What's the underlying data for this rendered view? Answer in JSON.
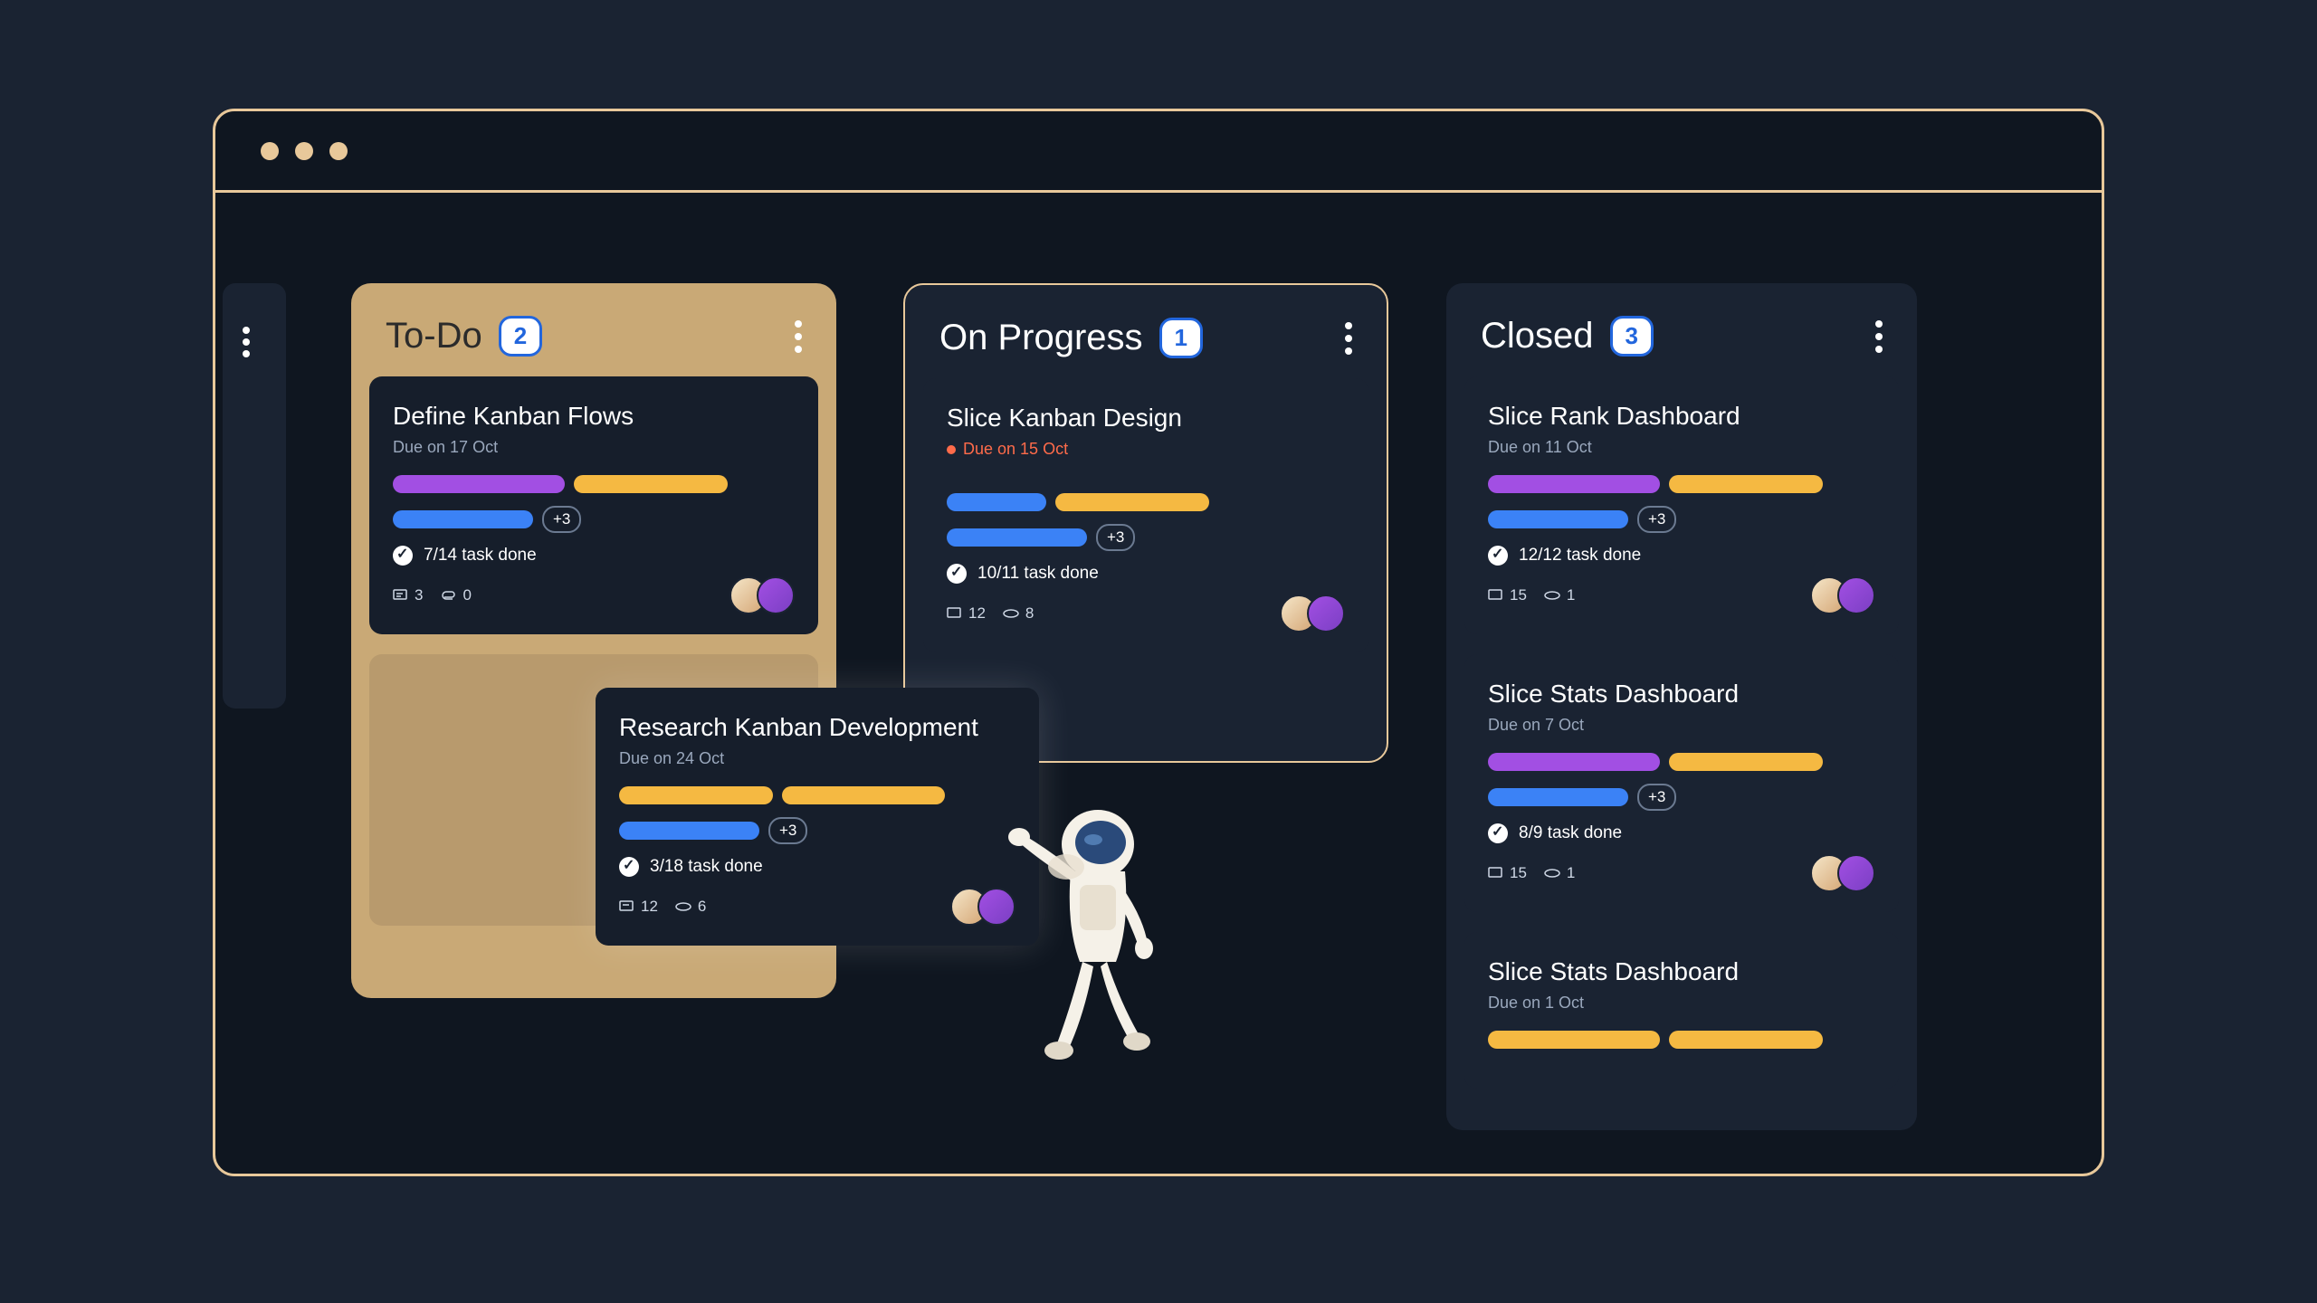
{
  "columns": {
    "todo": {
      "title": "To-Do",
      "count": "2"
    },
    "progress": {
      "title": "On Progress",
      "count": "1"
    },
    "closed": {
      "title": "Closed",
      "count": "3"
    }
  },
  "cards": {
    "todo1": {
      "title": "Define Kanban Flows",
      "due": "Due on 17 Oct",
      "more": "+3",
      "progress": "7/14 task done",
      "comments": "3",
      "attachments": "0"
    },
    "floating": {
      "title": "Research Kanban Development",
      "due": "Due on 24 Oct",
      "more": "+3",
      "progress": "3/18 task done",
      "comments": "12",
      "attachments": "6"
    },
    "prog1": {
      "title": "Slice Kanban Design",
      "due": "Due on 15 Oct",
      "more": "+3",
      "progress": "10/11 task done",
      "comments": "12",
      "attachments": "8"
    },
    "closed1": {
      "title": "Slice Rank Dashboard",
      "due": "Due on 11 Oct",
      "more": "+3",
      "progress": "12/12 task done",
      "comments": "15",
      "attachments": "1"
    },
    "closed2": {
      "title": "Slice Stats Dashboard",
      "due": "Due on 7 Oct",
      "more": "+3",
      "progress": "8/9 task done",
      "comments": "15",
      "attachments": "1"
    },
    "closed3": {
      "title": "Slice Stats Dashboard",
      "due": "Due on 1 Oct"
    }
  }
}
